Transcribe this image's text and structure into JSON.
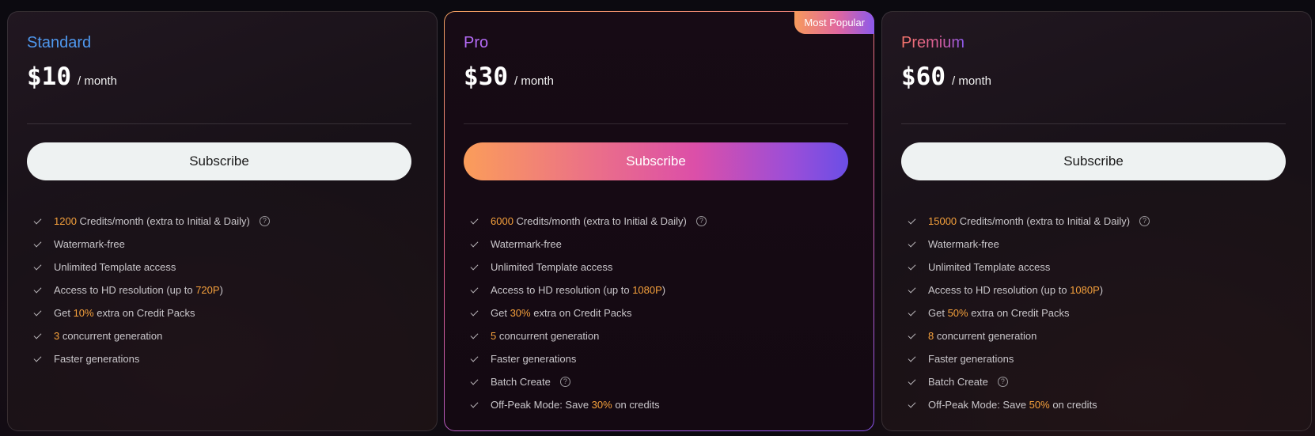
{
  "colors": {
    "highlight": "#f6a13c",
    "standard_name": "#4f98ee",
    "pro_name": "#b46bf6",
    "premium_name_gradient": [
      "#f7766a",
      "#8b59ec"
    ],
    "pro_button_gradient": [
      "#fb9d5a",
      "#dc4fa8",
      "#6b4ee6"
    ],
    "plain_button": "#eef2f2"
  },
  "icons": {
    "check": "check-icon",
    "help": "help-circle-icon"
  },
  "plans": [
    {
      "name": "Standard",
      "price": "$10",
      "period": "/ month",
      "button": "Subscribe",
      "features": [
        {
          "pre": "",
          "hl": "1200",
          "post": " Credits/month (extra to Initial & Daily)",
          "help": true
        },
        {
          "pre": "Watermark-free",
          "hl": "",
          "post": "",
          "help": false
        },
        {
          "pre": "Unlimited Template access",
          "hl": "",
          "post": "",
          "help": false
        },
        {
          "pre": "Access to HD resolution (up to ",
          "hl": "720P",
          "post": ")",
          "help": false
        },
        {
          "pre": "Get ",
          "hl": "10%",
          "post": " extra on Credit Packs",
          "help": false
        },
        {
          "pre": "",
          "hl": "3",
          "post": " concurrent generation",
          "help": false
        },
        {
          "pre": "Faster generations",
          "hl": "",
          "post": "",
          "help": false
        }
      ]
    },
    {
      "name": "Pro",
      "badge": "Most Popular",
      "price": "$30",
      "period": "/ month",
      "button": "Subscribe",
      "features": [
        {
          "pre": "",
          "hl": "6000",
          "post": " Credits/month (extra to Initial & Daily)",
          "help": true
        },
        {
          "pre": "Watermark-free",
          "hl": "",
          "post": "",
          "help": false
        },
        {
          "pre": "Unlimited Template access",
          "hl": "",
          "post": "",
          "help": false
        },
        {
          "pre": "Access to HD resolution (up to ",
          "hl": "1080P",
          "post": ")",
          "help": false
        },
        {
          "pre": "Get ",
          "hl": "30%",
          "post": " extra on Credit Packs",
          "help": false
        },
        {
          "pre": "",
          "hl": "5",
          "post": " concurrent generation",
          "help": false
        },
        {
          "pre": "Faster generations",
          "hl": "",
          "post": "",
          "help": false
        },
        {
          "pre": "Batch Create",
          "hl": "",
          "post": "",
          "help": true
        },
        {
          "pre": "Off-Peak Mode: Save ",
          "hl": "30%",
          "post": " on credits",
          "help": false
        }
      ]
    },
    {
      "name": "Premium",
      "price": "$60",
      "period": "/ month",
      "button": "Subscribe",
      "features": [
        {
          "pre": "",
          "hl": "15000",
          "post": " Credits/month (extra to Initial & Daily)",
          "help": true
        },
        {
          "pre": "Watermark-free",
          "hl": "",
          "post": "",
          "help": false
        },
        {
          "pre": "Unlimited Template access",
          "hl": "",
          "post": "",
          "help": false
        },
        {
          "pre": "Access to HD resolution (up to ",
          "hl": "1080P",
          "post": ")",
          "help": false
        },
        {
          "pre": "Get ",
          "hl": "50%",
          "post": " extra on Credit Packs",
          "help": false
        },
        {
          "pre": "",
          "hl": "8",
          "post": " concurrent generation",
          "help": false
        },
        {
          "pre": "Faster generations",
          "hl": "",
          "post": "",
          "help": false
        },
        {
          "pre": "Batch Create",
          "hl": "",
          "post": "",
          "help": true
        },
        {
          "pre": "Off-Peak Mode: Save ",
          "hl": "50%",
          "post": " on credits",
          "help": false
        }
      ]
    }
  ]
}
